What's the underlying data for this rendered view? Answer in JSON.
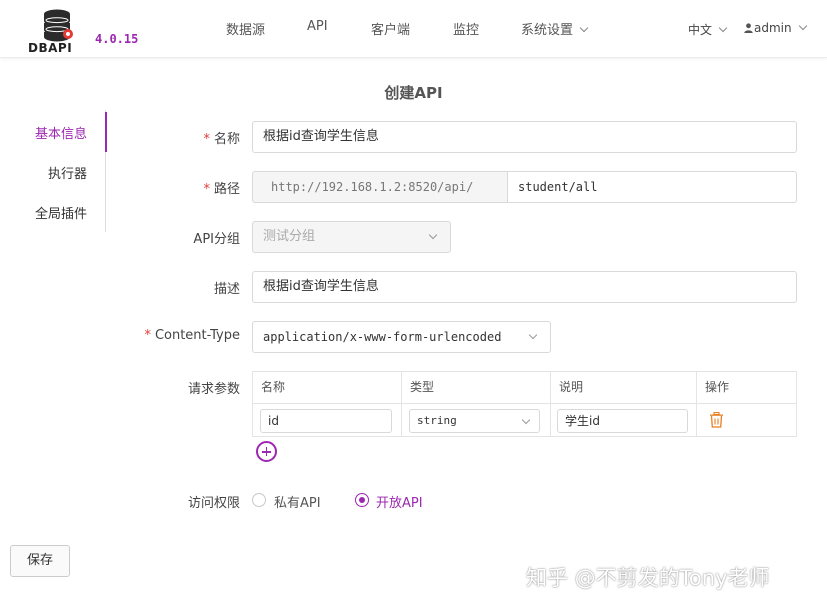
{
  "header": {
    "logo_text": "DBAPI",
    "version": "4.0.15",
    "nav": [
      "数据源",
      "API",
      "客户端",
      "监控",
      "系统设置"
    ],
    "lang": "中文",
    "user": "admin"
  },
  "sidebar": {
    "items": [
      {
        "label": "基本信息",
        "active": true
      },
      {
        "label": "执行器",
        "active": false
      },
      {
        "label": "全局插件",
        "active": false
      }
    ]
  },
  "form": {
    "title": "创建API",
    "name_label": "名称",
    "name_value": "根据id查询学生信息",
    "path_label": "路径",
    "path_prefix": "http://192.168.1.2:8520/api/",
    "path_value": "student/all",
    "group_label": "API分组",
    "group_value": "测试分组",
    "desc_label": "描述",
    "desc_value": "根据id查询学生信息",
    "ctype_label": "Content-Type",
    "ctype_value": "application/x-www-form-urlencoded",
    "params_label": "请求参数",
    "params_columns": [
      "名称",
      "类型",
      "说明",
      "操作"
    ],
    "params_rows": [
      {
        "name": "id",
        "type": "string",
        "desc": "学生id"
      }
    ],
    "access_label": "访问权限",
    "access_options": [
      {
        "label": "私有API",
        "checked": false
      },
      {
        "label": "开放API",
        "checked": true
      }
    ],
    "save_label": "保存"
  },
  "watermark": "知乎 @不剪发的Tony老师",
  "colors": {
    "accent": "#9c27b0",
    "required": "#e53935",
    "delete": "#e67e22"
  }
}
